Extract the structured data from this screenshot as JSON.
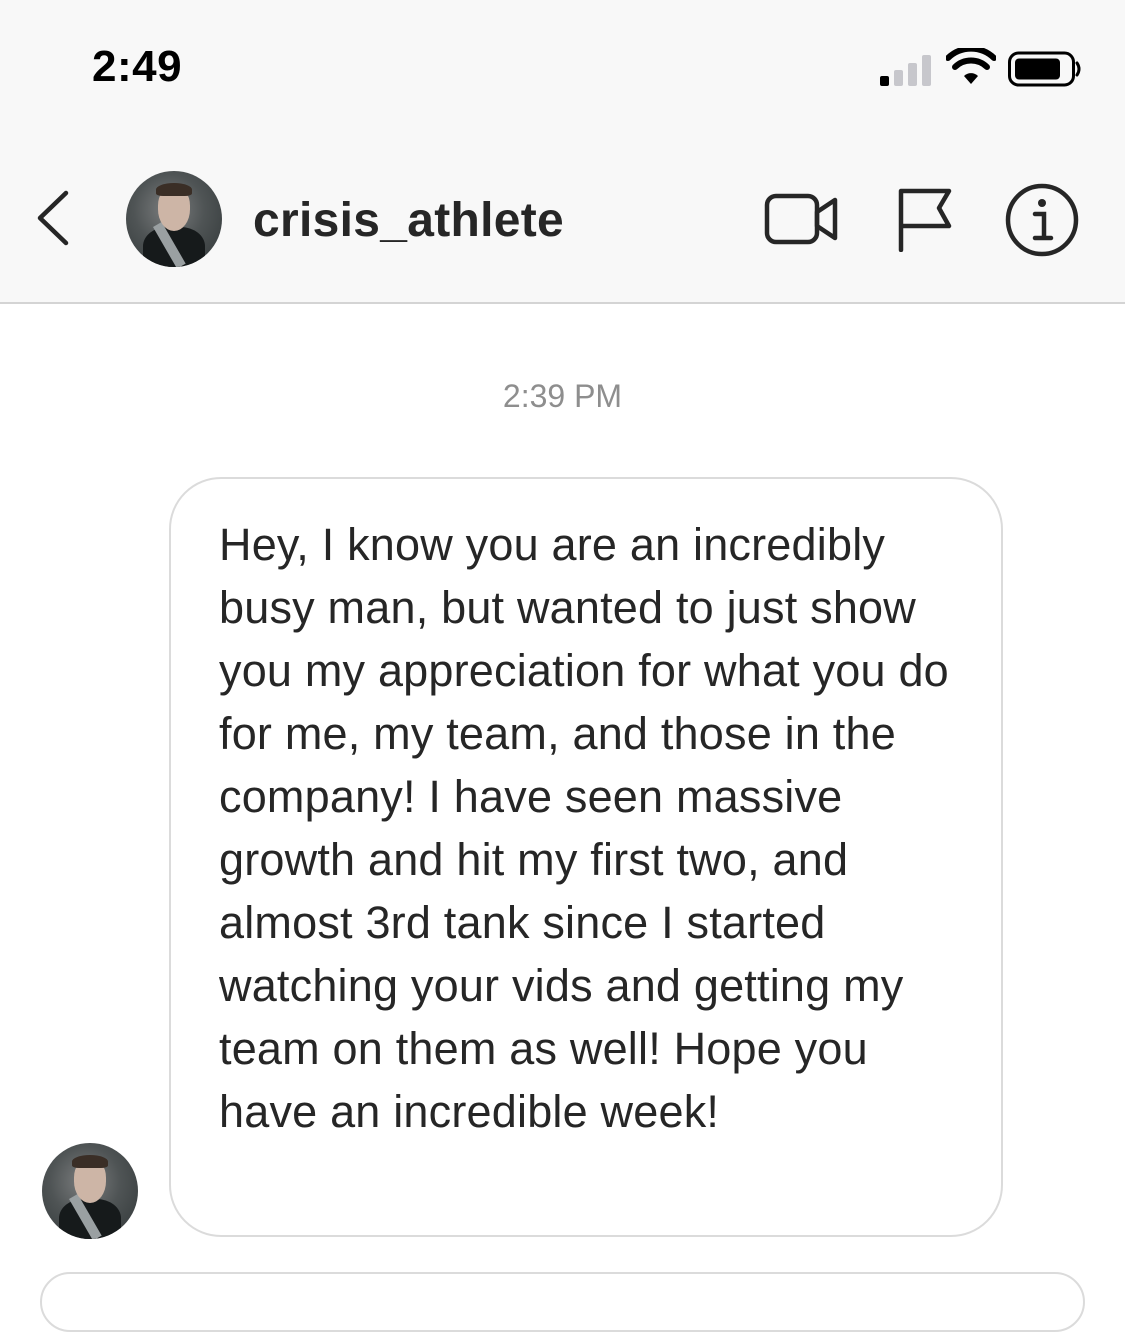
{
  "status_bar": {
    "time": "2:49",
    "signal_icon": "cellular-signal-icon",
    "wifi_icon": "wifi-icon",
    "battery_icon": "battery-icon"
  },
  "header": {
    "back_icon": "chevron-left-icon",
    "avatar_icon": "profile-avatar",
    "username": "crisis_athlete",
    "actions": [
      {
        "name": "video-call",
        "icon": "video-camera-icon"
      },
      {
        "name": "report",
        "icon": "flag-icon"
      },
      {
        "name": "info",
        "icon": "info-icon"
      }
    ]
  },
  "conversation": {
    "timestamp": "2:39 PM",
    "messages": [
      {
        "sender": "crisis_athlete",
        "text": "Hey, I know you are an incredibly busy man, but wanted to just show you my appreciation for what you do for me, my team, and those in the company! I have seen massive growth and hit my first two, and almost 3rd tank since I started watching your vids and getting my team on them as well! Hope you have an incredible week!"
      }
    ]
  },
  "colors": {
    "header_bg": "#f8f8f8",
    "text": "#262626",
    "muted": "#8e8e8e",
    "bubble_border": "#dbdbdb"
  }
}
